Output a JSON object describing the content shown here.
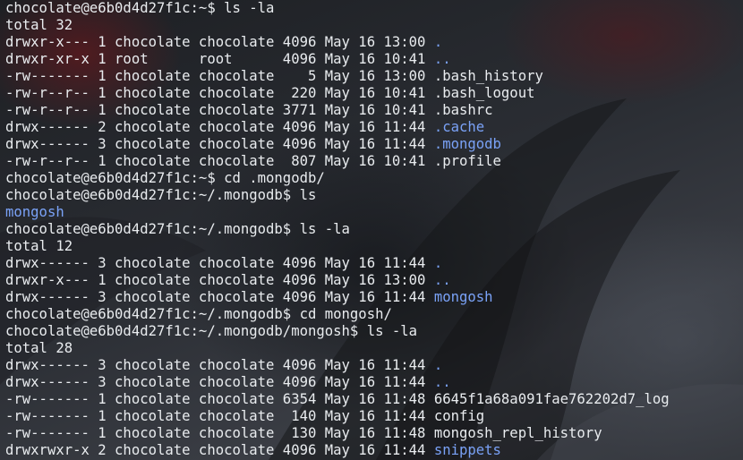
{
  "terminal": {
    "colors": {
      "text": "#e9ecef",
      "directory": "#7aa2f7",
      "background": "#23262b"
    },
    "lines": [
      {
        "text": "chocolate@e6b0d4d27f1c:~$ ls -la",
        "kind": "prompt"
      },
      {
        "text": "total 32",
        "kind": "output"
      },
      {
        "text": "drwxr-x--- 1 chocolate chocolate 4096 May 16 13:00 ",
        "name": ".",
        "kind": "dir-entry"
      },
      {
        "text": "drwxr-xr-x 1 root      root      4096 May 16 10:41 ",
        "name": "..",
        "kind": "dir-entry"
      },
      {
        "text": "-rw------- 1 chocolate chocolate    5 May 16 13:00 ",
        "name": ".bash_history",
        "kind": "file-entry"
      },
      {
        "text": "-rw-r--r-- 1 chocolate chocolate  220 May 16 10:41 ",
        "name": ".bash_logout",
        "kind": "file-entry"
      },
      {
        "text": "-rw-r--r-- 1 chocolate chocolate 3771 May 16 10:41 ",
        "name": ".bashrc",
        "kind": "file-entry"
      },
      {
        "text": "drwx------ 2 chocolate chocolate 4096 May 16 11:44 ",
        "name": ".cache",
        "kind": "dir-entry"
      },
      {
        "text": "drwx------ 3 chocolate chocolate 4096 May 16 11:44 ",
        "name": ".mongodb",
        "kind": "dir-entry"
      },
      {
        "text": "-rw-r--r-- 1 chocolate chocolate  807 May 16 10:41 ",
        "name": ".profile",
        "kind": "file-entry"
      },
      {
        "text": "chocolate@e6b0d4d27f1c:~$ cd .mongodb/",
        "kind": "prompt"
      },
      {
        "text": "chocolate@e6b0d4d27f1c:~/.mongodb$ ls",
        "kind": "prompt"
      },
      {
        "text": "",
        "name": "mongosh",
        "kind": "dir-entry"
      },
      {
        "text": "chocolate@e6b0d4d27f1c:~/.mongodb$ ls -la",
        "kind": "prompt"
      },
      {
        "text": "total 12",
        "kind": "output"
      },
      {
        "text": "drwx------ 3 chocolate chocolate 4096 May 16 11:44 ",
        "name": ".",
        "kind": "dir-entry"
      },
      {
        "text": "drwxr-x--- 1 chocolate chocolate 4096 May 16 13:00 ",
        "name": "..",
        "kind": "dir-entry"
      },
      {
        "text": "drwx------ 3 chocolate chocolate 4096 May 16 11:44 ",
        "name": "mongosh",
        "kind": "dir-entry"
      },
      {
        "text": "chocolate@e6b0d4d27f1c:~/.mongodb$ cd mongosh/",
        "kind": "prompt"
      },
      {
        "text": "chocolate@e6b0d4d27f1c:~/.mongodb/mongosh$ ls -la",
        "kind": "prompt"
      },
      {
        "text": "total 28",
        "kind": "output"
      },
      {
        "text": "drwx------ 3 chocolate chocolate 4096 May 16 11:44 ",
        "name": ".",
        "kind": "dir-entry"
      },
      {
        "text": "drwx------ 3 chocolate chocolate 4096 May 16 11:44 ",
        "name": "..",
        "kind": "dir-entry"
      },
      {
        "text": "-rw------- 1 chocolate chocolate 6354 May 16 11:48 ",
        "name": "6645f1a68a091fae762202d7_log",
        "kind": "file-entry"
      },
      {
        "text": "-rw------- 1 chocolate chocolate  140 May 16 11:44 ",
        "name": "config",
        "kind": "file-entry"
      },
      {
        "text": "-rw------- 1 chocolate chocolate  130 May 16 11:48 ",
        "name": "mongosh_repl_history",
        "kind": "file-entry"
      },
      {
        "text": "drwxrwxr-x 2 chocolate chocolate 4096 May 16 11:44 ",
        "name": "snippets",
        "kind": "dir-entry"
      }
    ]
  }
}
